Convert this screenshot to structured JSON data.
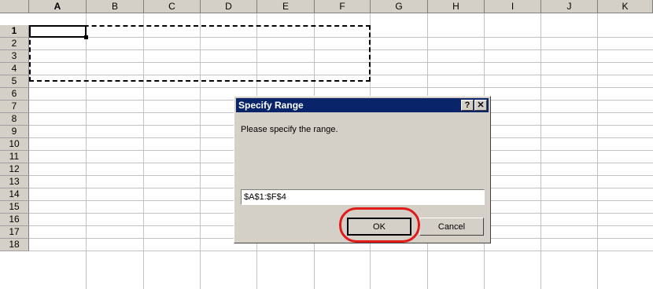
{
  "spreadsheet": {
    "columns": [
      "A",
      "B",
      "C",
      "D",
      "E",
      "F",
      "G",
      "H",
      "I",
      "J",
      "K"
    ],
    "rows": [
      "1",
      "2",
      "3",
      "4",
      "5",
      "6",
      "7",
      "8",
      "9",
      "10",
      "11",
      "12",
      "13",
      "14",
      "15",
      "16",
      "17",
      "18"
    ],
    "active_column": "A",
    "active_row": "1",
    "active_cell": "A1"
  },
  "dialog": {
    "title": "Specify Range",
    "help_label": "?",
    "close_label": "✕",
    "prompt": "Please specify the range.",
    "range_value": "$A$1:$F$4",
    "ok_label": "OK",
    "cancel_label": "Cancel"
  },
  "colors": {
    "title_bar": "#0a246a",
    "dialog_face": "#d4d0c8",
    "highlight": "#e11a1a"
  }
}
